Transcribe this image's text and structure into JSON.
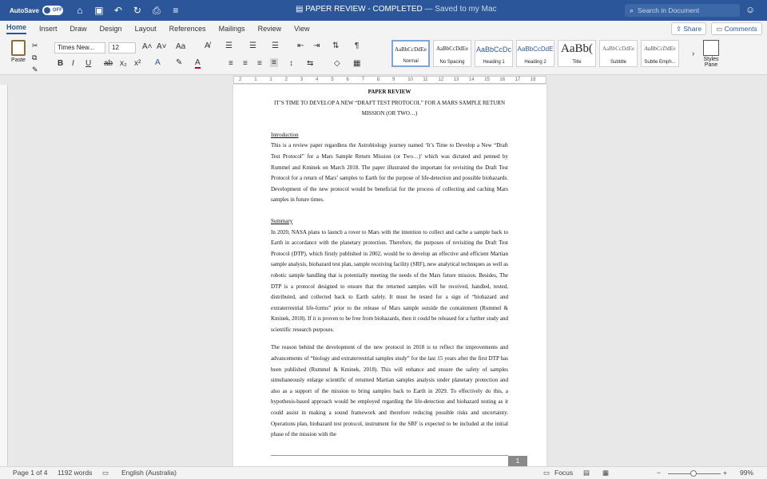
{
  "titlebar": {
    "autosave_label": "AutoSave",
    "autosave_state": "OFF",
    "doc_name": "PAPER REVIEW - COMPLETED",
    "saved_status": "— Saved to my Mac",
    "search_placeholder": "Search in Document"
  },
  "tabs": [
    "Home",
    "Insert",
    "Draw",
    "Design",
    "Layout",
    "References",
    "Mailings",
    "Review",
    "View"
  ],
  "share_label": "Share",
  "comments_label": "Comments",
  "ribbon": {
    "paste_label": "Paste",
    "font_name": "Times New...",
    "font_size": "12",
    "styles": [
      {
        "preview": "AaBbCcDdEe",
        "name": "Normal",
        "kind": "normal"
      },
      {
        "preview": "AaBbCcDdEe",
        "name": "No Spacing",
        "kind": "normal"
      },
      {
        "preview": "AaBbCcDc",
        "name": "Heading 1",
        "kind": "head"
      },
      {
        "preview": "AaBbCcDdE",
        "name": "Heading 2",
        "kind": "head"
      },
      {
        "preview": "AaBb(",
        "name": "Title",
        "kind": "big"
      },
      {
        "preview": "AaBbCcDdEe",
        "name": "Subtitle",
        "kind": "normal"
      },
      {
        "preview": "AaBbCcDdEe",
        "name": "Subtle Emph...",
        "kind": "normal"
      }
    ],
    "styles_pane_label": "Styles Pane"
  },
  "ruler_marks": [
    "2",
    "1",
    "1",
    "2",
    "3",
    "4",
    "5",
    "6",
    "7",
    "8",
    "9",
    "10",
    "11",
    "12",
    "13",
    "14",
    "15",
    "16",
    "17",
    "18"
  ],
  "document": {
    "title": "PAPER REVIEW",
    "subtitle": "IT’S TIME TO DEVELOP A NEW “DRAFT TEST PROTOCOL” FOR A MARS SAMPLE RETURN MISSION (OR TWO…)",
    "intro_heading": "Introduction",
    "intro_text": "This is a review paper regardless the Astrobiology journey named ‘It’s Time to Develop a New “Draft Test Protocol” for a Mars Sample Return Mission (or Two…)’ which was dictated and penned by Rummel and Kminek on March 2018. The paper illustrated the important for revisiting the Draft Test Protocol for a return of Mars’ samples to Earth for the purpose of life-detection and possible biohazards. Development of the new protocol would be beneficial for the process of collecting and caching Mars samples in future times.",
    "summary_heading": "Summary",
    "summary_text": "In 2020, NASA plans to launch a rover to Mars with the intention to collect and cache a sample back to Earth in accordance with the planetary protection. Therefore, the purposes of revisiting the Draft Test Protocol (DTP), which firstly published in 2002, would be to develop an effective and efficient Martian sample analysis, biohazard test plan, sample receiving facility (SRF), new analytical techniques as well as robotic sample handling that is potentially meeting the needs of the Mars future mission. Besides, The DTP is a protocol designed to ensure that the returned samples will be received, handled, tested, distributed, and collected back to Earth safely. It must be tested for a sign of “biohazard and extraterrestrial life-forms” prior to the release of Mars sample outside the containment (Rummel & Kminek, 2018). If it is proven to be free from biohazards, then it could be released for a further study and scientific research purposes.",
    "reason_text": "The reason behind the development of the new protocol in 2018 is to reflect the improvements and advancements of “biology and extraterrestrial samples study” for the last 15 years after the first DTP has been published (Rummel & Kminek, 2018). This will enhance and ensure the safety of samples simultaneously enlarge scientific of returned Martian samples analysis under planetary protection and also as a support of the mission to bring samples back to Earth in 2029. To effectively do this, a hypothesis-based approach would be employed regarding the life-detection and biohazard testing as it could assist in making a sound framework and therefore reducing possible risks and uncertainty. Operations plan, biohazard test protocol, instrument for the SRF is expected to be included at the initial phase of the mission with the",
    "page_number": "1"
  },
  "statusbar": {
    "page": "Page 1 of 4",
    "words": "1192 words",
    "language": "English (Australia)",
    "focus": "Focus",
    "zoom": "99%"
  }
}
